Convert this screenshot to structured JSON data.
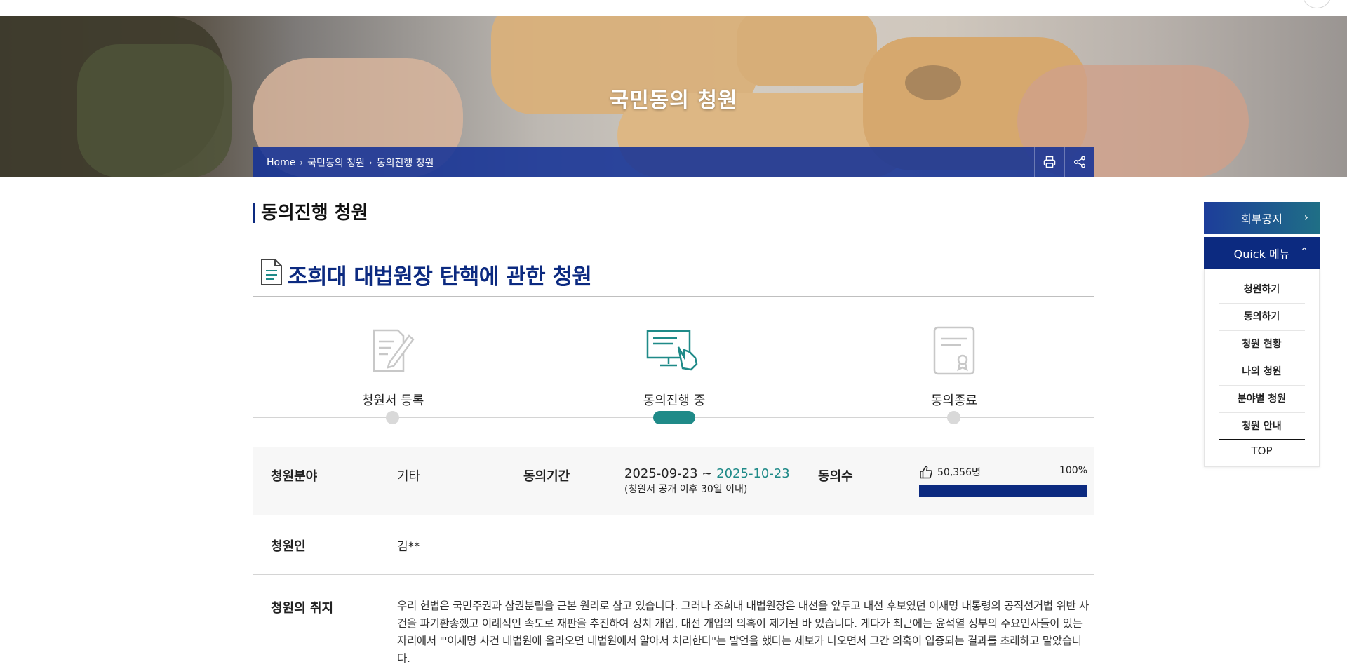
{
  "hero": {
    "title": "국민동의 청원"
  },
  "breadcrumb": {
    "items": [
      "Home",
      "국민동의 청원",
      "동의진행 청원"
    ]
  },
  "section": {
    "title": "동의진행 청원"
  },
  "petition": {
    "title": "조희대 대법원장 탄핵에 관한 청원",
    "steps": [
      "청원서 등록",
      "동의진행 중",
      "동의종료"
    ],
    "active_step": 2,
    "field_label": "청원분야",
    "field_value": "기타",
    "period_label": "동의기간",
    "period_start": "2025-09-23",
    "period_sep": " ~ ",
    "period_end": "2025-10-23",
    "period_note": "(청원서 공개 이후 30일 이내)",
    "votes_label": "동의수",
    "votes_count": "50,356명",
    "votes_percent": "100%",
    "votes_progress": 1.0,
    "petitioner_label": "청원인",
    "petitioner_value": "김**",
    "purpose_label": "청원의 취지",
    "purpose_text": "우리 헌법은 국민주권과 삼권분립을 근본 원리로 삼고 있습니다. 그러나 조희대 대법원장은 대선을 앞두고 대선 후보였던 이재명 대통령의 공직선거법 위반 사건을 파기환송했고 이례적인 속도로 재판을 추진하여 정치 개입, 대선 개입의 의혹이 제기된 바 있습니다. 게다가 최근에는 윤석열 정부의 주요인사들이 있는 자리에서 \"'이재명 사건 대법원에 올라오면 대법원에서 알아서 처리한다\"는 발언을 했다는 제보가 나오면서 그간 의혹이 입증되는 결과를 초래하고 말았습니다."
  },
  "quick_menu": {
    "notice_label": "회부공지",
    "title": "Quick 메뉴",
    "items": [
      "청원하기",
      "동의하기",
      "청원 현황",
      "나의 청원",
      "분야별 청원",
      "청원 안내"
    ],
    "top_label": "TOP"
  },
  "colors": {
    "primary": "#0c2a80",
    "accent": "#1f8a88",
    "muted": "#d9d9d9"
  },
  "icons": [
    "print-icon",
    "share-icon",
    "document-icon",
    "petition-register-icon",
    "consent-progress-icon",
    "consent-end-icon",
    "thumbs-up-icon"
  ]
}
